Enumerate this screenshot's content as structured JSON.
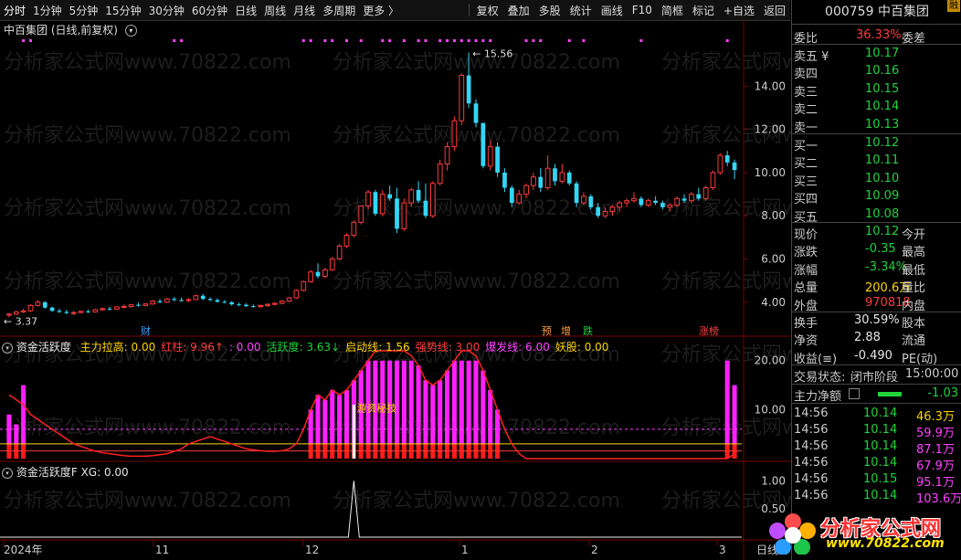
{
  "toolbar": {
    "periods": [
      "分时",
      "1分钟",
      "5分钟",
      "15分钟",
      "30分钟",
      "60分钟",
      "日线",
      "周线",
      "月线",
      "多周期",
      "更多 〉"
    ],
    "buttons": [
      "复权",
      "叠加",
      "多股",
      "统计",
      "画线",
      "F10",
      "简框",
      "标记",
      "+自选",
      "返回"
    ]
  },
  "chart_title": "中百集团 (日线,前复权)",
  "indicator1": {
    "name": "资金活跃度",
    "labels": [
      {
        "text": "主力拉高: 0.00",
        "color": "#ffd400"
      },
      {
        "text": "红柱: 9.96↑",
        "color": "#ff3b3b"
      },
      {
        "text": ": 0.00",
        "color": "#ff40ff"
      },
      {
        "text": "活跃度: 3.63↓",
        "color": "#1fd33b"
      },
      {
        "text": "启动线: 1.56",
        "color": "#ffd400"
      },
      {
        "text": "强势线: 3.00",
        "color": "#ff3b3b"
      },
      {
        "text": "爆发线: 6.00",
        "color": "#ff40ff"
      },
      {
        "text": "妖股: 0.00",
        "color": "#ffd400"
      }
    ],
    "annotation": "游资秘技"
  },
  "indicator2": {
    "name": "资金活跃度F",
    "label": "XG: 0.00"
  },
  "markers": {
    "cai": "财",
    "yu": "预",
    "zeng": "增",
    "die": "跌",
    "jiebang": "涨榜"
  },
  "price_labels": {
    "high": "15.56",
    "low": "3.37"
  },
  "x_axis": [
    "2024年",
    "11",
    "12",
    "1",
    "2",
    "3"
  ],
  "x_axis_right": "日线",
  "right_panel": {
    "code": "000759",
    "name": "中百集团",
    "badge": "融",
    "weibi_label": "委比",
    "weibi_val": "36.33%",
    "weicha_label": "委差",
    "sell": [
      {
        "label": "卖五 ¥",
        "price": "10.17"
      },
      {
        "label": "卖四",
        "price": "10.16"
      },
      {
        "label": "卖三",
        "price": "10.15"
      },
      {
        "label": "卖二",
        "price": "10.14"
      },
      {
        "label": "卖一",
        "price": "10.13"
      }
    ],
    "buy": [
      {
        "label": "买一",
        "price": "10.12"
      },
      {
        "label": "买二",
        "price": "10.11"
      },
      {
        "label": "买三",
        "price": "10.10"
      },
      {
        "label": "买四",
        "price": "10.09"
      },
      {
        "label": "买五",
        "price": "10.08"
      }
    ],
    "stats": [
      {
        "l1": "现价",
        "v1": "10.12",
        "c1": "#1fd33b",
        "l2": "今开",
        "v2": "",
        "c2": "#ccc"
      },
      {
        "l1": "涨跌",
        "v1": "-0.35",
        "c1": "#1fd33b",
        "l2": "最高",
        "v2": "",
        "c2": "#ccc"
      },
      {
        "l1": "涨幅",
        "v1": "-3.34%",
        "c1": "#1fd33b",
        "l2": "最低",
        "v2": "",
        "c2": "#ccc"
      },
      {
        "l1": "总量",
        "v1": "200.6万",
        "c1": "#ffd400",
        "l2": "量比",
        "v2": "",
        "c2": "#ccc"
      },
      {
        "l1": "外盘",
        "v1": "970818",
        "c1": "#ff3b3b",
        "l2": "内盘",
        "v2": "",
        "c2": "#ccc"
      }
    ],
    "stats2": [
      {
        "l1": "换手",
        "v1": "30.59%",
        "c1": "#e6e6e6",
        "l2": "股本"
      },
      {
        "l1": "净资",
        "v1": "2.88",
        "c1": "#e6e6e6",
        "l2": "流通"
      },
      {
        "l1": "收益(≡)",
        "v1": "-0.490",
        "c1": "#e6e6e6",
        "l2": "PE(动)"
      }
    ],
    "status_label": "交易状态:",
    "status_val": "闭市阶段",
    "status_time": "15:00:00",
    "net_label": "主力净额",
    "net_val": "-1.03",
    "ticks": [
      {
        "t": "14:56",
        "p": "10.14",
        "v": "46.3万",
        "vc": "#ffd400"
      },
      {
        "t": "14:56",
        "p": "10.14",
        "v": "59.9万",
        "vc": "#ff40ff"
      },
      {
        "t": "14:56",
        "p": "10.14",
        "v": "87.1万",
        "vc": "#ff40ff"
      },
      {
        "t": "14:56",
        "p": "10.14",
        "v": "67.9万",
        "vc": "#ff40ff"
      },
      {
        "t": "14:56",
        "p": "10.15",
        "v": "95.1万",
        "vc": "#ff40ff"
      },
      {
        "t": "14:56",
        "p": "10.14",
        "v": "103.6万",
        "vc": "#ff40ff"
      }
    ]
  },
  "watermark": {
    "text": "分析家公式网",
    "url": "www.70822.com"
  },
  "chart_data": [
    {
      "type": "candlestick",
      "title": "中百集团 (日线,前复权)",
      "ylim": [
        3.4,
        16.3
      ],
      "y_ticks": [
        4.0,
        6.0,
        8.0,
        10.0,
        12.0,
        14.0
      ],
      "candles": [
        [
          3.4,
          3.5,
          3.3,
          3.45
        ],
        [
          3.45,
          3.6,
          3.4,
          3.55
        ],
        [
          3.55,
          3.7,
          3.5,
          3.6
        ],
        [
          3.6,
          3.9,
          3.55,
          3.85
        ],
        [
          3.85,
          4.1,
          3.8,
          4.0
        ],
        [
          4.0,
          4.05,
          3.7,
          3.75
        ],
        [
          3.75,
          3.8,
          3.55,
          3.6
        ],
        [
          3.6,
          3.7,
          3.5,
          3.55
        ],
        [
          3.55,
          3.65,
          3.45,
          3.5
        ],
        [
          3.5,
          3.6,
          3.4,
          3.52
        ],
        [
          3.52,
          3.62,
          3.48,
          3.58
        ],
        [
          3.58,
          3.66,
          3.5,
          3.55
        ],
        [
          3.55,
          3.7,
          3.52,
          3.65
        ],
        [
          3.65,
          3.75,
          3.6,
          3.7
        ],
        [
          3.7,
          3.8,
          3.62,
          3.68
        ],
        [
          3.68,
          3.82,
          3.65,
          3.78
        ],
        [
          3.78,
          3.9,
          3.72,
          3.8
        ],
        [
          3.8,
          3.92,
          3.75,
          3.88
        ],
        [
          3.88,
          3.98,
          3.8,
          3.85
        ],
        [
          3.85,
          3.95,
          3.8,
          3.92
        ],
        [
          3.92,
          4.1,
          3.88,
          4.05
        ],
        [
          4.05,
          4.15,
          3.95,
          4.0
        ],
        [
          4.0,
          4.2,
          3.98,
          4.15
        ],
        [
          4.15,
          4.25,
          4.05,
          4.1
        ],
        [
          4.1,
          4.22,
          4.02,
          4.08
        ],
        [
          4.08,
          4.18,
          4.0,
          4.12
        ],
        [
          4.12,
          4.35,
          4.1,
          4.3
        ],
        [
          4.3,
          4.38,
          4.1,
          4.15
        ],
        [
          4.15,
          4.22,
          4.05,
          4.1
        ],
        [
          4.1,
          4.18,
          3.98,
          4.02
        ],
        [
          4.02,
          4.1,
          3.95,
          4.0
        ],
        [
          4.0,
          4.05,
          3.85,
          3.9
        ],
        [
          3.9,
          3.98,
          3.82,
          3.88
        ],
        [
          3.88,
          3.95,
          3.78,
          3.82
        ],
        [
          3.82,
          3.9,
          3.75,
          3.8
        ],
        [
          3.8,
          3.88,
          3.72,
          3.85
        ],
        [
          3.85,
          3.95,
          3.78,
          3.9
        ],
        [
          3.9,
          4.0,
          3.85,
          3.95
        ],
        [
          3.95,
          4.1,
          3.9,
          4.05
        ],
        [
          4.05,
          4.25,
          4.0,
          4.2
        ],
        [
          4.2,
          4.6,
          4.15,
          4.55
        ],
        [
          4.55,
          5.0,
          4.5,
          4.95
        ],
        [
          4.95,
          5.5,
          4.9,
          5.4
        ],
        [
          5.4,
          5.8,
          5.1,
          5.2
        ],
        [
          5.2,
          5.6,
          5.1,
          5.5
        ],
        [
          5.5,
          6.1,
          5.45,
          6.0
        ],
        [
          6.0,
          6.7,
          5.95,
          6.6
        ],
        [
          6.6,
          7.2,
          6.5,
          7.1
        ],
        [
          7.1,
          7.8,
          7.0,
          7.7
        ],
        [
          7.7,
          8.5,
          7.6,
          8.45
        ],
        [
          8.45,
          9.2,
          8.3,
          9.1
        ],
        [
          9.1,
          9.2,
          8.0,
          8.1
        ],
        [
          8.1,
          9.2,
          8.0,
          9.0
        ],
        [
          9.0,
          9.4,
          8.7,
          8.8
        ],
        [
          8.8,
          9.3,
          7.2,
          7.4
        ],
        [
          7.4,
          8.8,
          7.3,
          8.6
        ],
        [
          8.6,
          9.3,
          8.4,
          9.2
        ],
        [
          9.2,
          9.6,
          8.6,
          8.7
        ],
        [
          8.7,
          9.5,
          7.9,
          8.0
        ],
        [
          8.0,
          9.6,
          7.9,
          9.5
        ],
        [
          9.5,
          10.6,
          9.4,
          10.4
        ],
        [
          10.4,
          11.4,
          10.1,
          11.2
        ],
        [
          11.2,
          12.6,
          11.0,
          12.4
        ],
        [
          12.4,
          14.6,
          12.2,
          14.5
        ],
        [
          14.5,
          15.56,
          13.0,
          13.2
        ],
        [
          13.2,
          13.4,
          12.1,
          12.3
        ],
        [
          12.3,
          11.4,
          10.2,
          10.3
        ],
        [
          10.3,
          11.5,
          10.1,
          11.2
        ],
        [
          11.2,
          11.4,
          9.8,
          10.0
        ],
        [
          10.0,
          10.2,
          9.1,
          9.3
        ],
        [
          9.3,
          9.4,
          8.4,
          8.6
        ],
        [
          8.6,
          9.2,
          8.5,
          9.0
        ],
        [
          9.0,
          9.5,
          8.8,
          9.4
        ],
        [
          9.4,
          10.0,
          9.2,
          9.8
        ],
        [
          9.8,
          10.2,
          9.1,
          9.3
        ],
        [
          9.3,
          10.8,
          9.2,
          10.2
        ],
        [
          10.2,
          10.4,
          9.4,
          9.6
        ],
        [
          9.6,
          10.4,
          9.5,
          10.0
        ],
        [
          10.0,
          10.1,
          9.4,
          9.5
        ],
        [
          9.5,
          9.6,
          8.4,
          8.6
        ],
        [
          8.6,
          9.1,
          8.5,
          8.9
        ],
        [
          8.9,
          9.0,
          8.3,
          8.4
        ],
        [
          8.4,
          8.6,
          7.9,
          8.0
        ],
        [
          8.0,
          8.4,
          7.9,
          8.2
        ],
        [
          8.2,
          8.5,
          8.0,
          8.4
        ],
        [
          8.4,
          8.7,
          8.2,
          8.6
        ],
        [
          8.6,
          8.8,
          8.4,
          8.7
        ],
        [
          8.7,
          9.1,
          8.6,
          8.8
        ],
        [
          8.8,
          8.9,
          8.4,
          8.5
        ],
        [
          8.5,
          8.8,
          8.4,
          8.7
        ],
        [
          8.7,
          8.9,
          8.5,
          8.6
        ],
        [
          8.6,
          8.7,
          8.3,
          8.4
        ],
        [
          8.4,
          8.6,
          8.2,
          8.5
        ],
        [
          8.5,
          8.9,
          8.4,
          8.8
        ],
        [
          8.8,
          9.0,
          8.6,
          8.7
        ],
        [
          8.7,
          9.1,
          8.6,
          9.0
        ],
        [
          9.0,
          9.3,
          8.7,
          8.8
        ],
        [
          8.8,
          9.4,
          8.7,
          9.3
        ],
        [
          9.3,
          10.1,
          9.2,
          10.0
        ],
        [
          10.0,
          10.9,
          9.9,
          10.8
        ],
        [
          10.8,
          11.0,
          10.3,
          10.47
        ],
        [
          10.47,
          10.6,
          9.7,
          10.12
        ]
      ]
    },
    {
      "type": "bar",
      "title": "资金活跃度",
      "ylim": [
        0,
        22
      ],
      "y_ticks": [
        10.0,
        20.0
      ],
      "red_bar_height": 3.0,
      "magenta": [
        9,
        7,
        15,
        0,
        0,
        0,
        0,
        0,
        0,
        0,
        0,
        0,
        0,
        0,
        0,
        0,
        0,
        0,
        0,
        0,
        0,
        0,
        0,
        0,
        0,
        0,
        0,
        0,
        0,
        0,
        0,
        0,
        0,
        0,
        0,
        0,
        0,
        0,
        0,
        0,
        0,
        0,
        0,
        0,
        0,
        0,
        0,
        0,
        0,
        0,
        0,
        0,
        0,
        0,
        0,
        0,
        0,
        0,
        0,
        0,
        0,
        0,
        0,
        0,
        0,
        0,
        0,
        0,
        0,
        0,
        0,
        0,
        0,
        0,
        0,
        0,
        0,
        0,
        0,
        0,
        0,
        0,
        0,
        0,
        0,
        0,
        0,
        0,
        0,
        0,
        0,
        0,
        0,
        0,
        0,
        0,
        0,
        0,
        0,
        0,
        0,
        0,
        0,
        0
      ],
      "line": [
        13,
        12,
        11,
        9,
        8,
        7,
        6,
        5,
        4,
        3,
        2.5,
        2,
        1.5,
        1.2,
        1,
        0.8,
        0.6,
        0.5,
        0.5,
        0.5,
        0.6,
        0.8,
        1,
        1.5,
        2,
        3,
        3.5,
        4,
        4.5,
        4,
        3.5,
        3,
        2.5,
        2,
        1.8,
        1.6,
        1.5,
        1.5,
        1.6,
        2,
        3,
        6,
        10,
        13,
        12,
        14,
        13,
        14,
        16,
        18,
        20,
        22,
        22,
        22,
        22,
        22,
        21,
        19,
        16,
        15,
        16,
        18,
        20,
        22,
        22,
        21,
        18,
        14,
        10,
        6,
        3,
        1,
        0,
        0,
        0,
        0,
        0,
        0,
        0,
        0,
        0,
        0,
        0,
        0,
        0,
        0,
        0,
        0,
        0,
        0,
        0,
        0,
        0,
        0,
        0,
        0,
        0,
        0,
        0,
        0,
        0,
        1,
        3,
        6,
        9,
        10
      ],
      "dashed_line": 6.0,
      "yellow_line": 3.0,
      "red_line": 1.56,
      "white_bar_index": 48
    },
    {
      "type": "line",
      "title": "资金活跃度F",
      "ylim": [
        0,
        1.2
      ],
      "y_ticks": [
        0.5,
        1.0
      ],
      "spike_index": 48,
      "spike_value": 1.0
    }
  ]
}
